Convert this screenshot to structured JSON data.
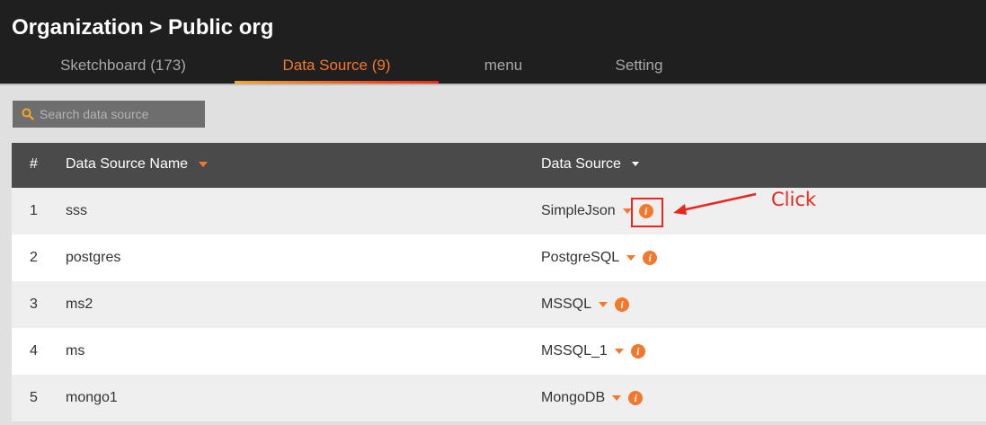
{
  "header": {
    "title": "Organization > Public org",
    "tabs": [
      {
        "label": "Sketchboard (173)",
        "active": false
      },
      {
        "label": "Data Source (9)",
        "active": true
      },
      {
        "label": "menu",
        "active": false
      },
      {
        "label": "Setting",
        "active": false
      }
    ]
  },
  "search": {
    "placeholder": "Search data source",
    "value": ""
  },
  "table": {
    "columns": [
      "#",
      "Data Source Name",
      "Data Source"
    ],
    "rows": [
      {
        "num": "1",
        "name": "sss",
        "source": "SimpleJson"
      },
      {
        "num": "2",
        "name": "postgres",
        "source": "PostgreSQL"
      },
      {
        "num": "3",
        "name": "ms2",
        "source": "MSSQL"
      },
      {
        "num": "4",
        "name": "ms",
        "source": "MSSQL_1"
      },
      {
        "num": "5",
        "name": "mongo1",
        "source": "MongoDB"
      }
    ]
  },
  "annotation": {
    "text": "Click",
    "color": "#e8281e"
  },
  "colors": {
    "accent": "#f2792b",
    "header_bg": "#1f1f1f",
    "table_header_bg": "#4a4a4a"
  },
  "icons": {
    "search": "search-icon",
    "info": "info-icon",
    "sort": "caret-down-icon"
  }
}
